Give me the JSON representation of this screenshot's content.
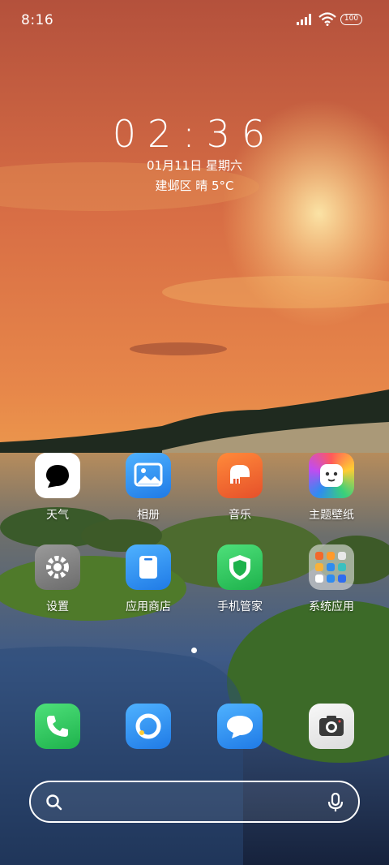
{
  "status_bar": {
    "time": "8:16",
    "battery": "100"
  },
  "lock_clock": {
    "time": "02:36",
    "date": "01月11日 星期六",
    "weather": "建邺区 晴 5°C"
  },
  "apps": [
    {
      "label": "天气",
      "icon": "weather-icon",
      "color": "#ffffff"
    },
    {
      "label": "相册",
      "icon": "gallery-icon",
      "color": "#2f8cf0"
    },
    {
      "label": "音乐",
      "icon": "music-icon",
      "color": "#f2692a"
    },
    {
      "label": "主题壁纸",
      "icon": "themes-icon",
      "color": "#ffcc33"
    },
    {
      "label": "设置",
      "icon": "settings-icon",
      "color": "#8a8a8a"
    },
    {
      "label": "应用商店",
      "icon": "app-store-icon",
      "color": "#2f8cf0"
    },
    {
      "label": "手机管家",
      "icon": "security-icon",
      "color": "#2ecc5a"
    },
    {
      "label": "系统应用",
      "icon": "folder-icon",
      "color": "#dedede"
    }
  ],
  "dock": [
    {
      "icon": "phone-icon",
      "color": "#2ecc5a"
    },
    {
      "icon": "browser-icon",
      "color": "#2f8cf0"
    },
    {
      "icon": "messages-icon",
      "color": "#2f8cf0"
    },
    {
      "icon": "camera-icon",
      "color": "#ececec"
    }
  ],
  "page_indicator": {
    "current": 1,
    "total": 1
  },
  "search": {
    "placeholder": ""
  }
}
